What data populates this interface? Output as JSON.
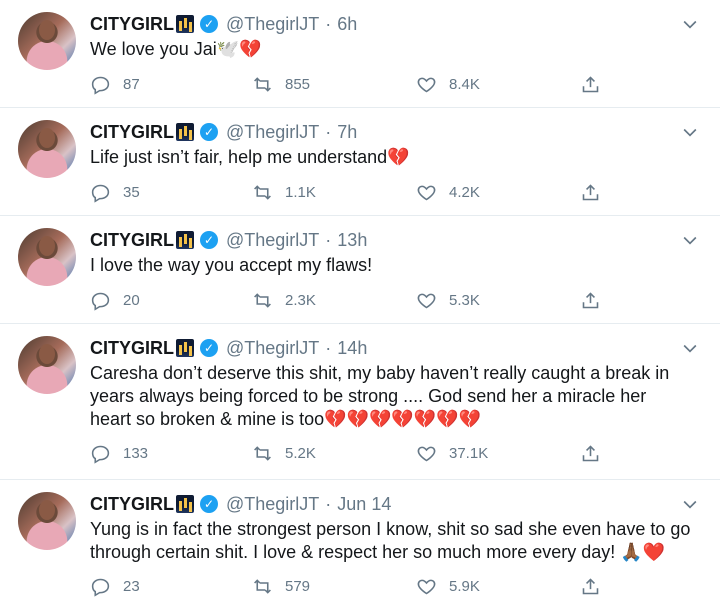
{
  "tweets": [
    {
      "name": "CITYGIRL",
      "handle": "@ThegirlJT",
      "time": "6h",
      "text": "We love you Jai",
      "emoji": "🕊️💔",
      "replies": "87",
      "retweets": "855",
      "likes": "8.4K"
    },
    {
      "name": "CITYGIRL",
      "handle": "@ThegirlJT",
      "time": "7h",
      "text": "Life just isn’t fair, help me understand",
      "emoji": "💔",
      "replies": "35",
      "retweets": "1.1K",
      "likes": "4.2K"
    },
    {
      "name": "CITYGIRL",
      "handle": "@ThegirlJT",
      "time": "13h",
      "text": "I love the way you accept my flaws!",
      "emoji": "",
      "replies": "20",
      "retweets": "2.3K",
      "likes": "5.3K"
    },
    {
      "name": "CITYGIRL",
      "handle": "@ThegirlJT",
      "time": "14h",
      "text": "Caresha don’t deserve this shit, my baby haven’t really caught a break in years always being forced to be strong .... God send her a miracle her heart so broken & mine is too",
      "emoji": "💔💔💔💔💔💔💔",
      "replies": "133",
      "retweets": "5.2K",
      "likes": "37.1K"
    },
    {
      "name": "CITYGIRL",
      "handle": "@ThegirlJT",
      "time": "Jun 14",
      "text": "Yung is in fact the strongest person I know, shit so sad she even have to go through certain shit. I love & respect her so much more every day!",
      "emoji": "🙏🏾❤️",
      "replies": "23",
      "retweets": "579",
      "likes": "5.9K"
    }
  ],
  "separator": "·",
  "icons": {
    "verified": "verified-badge-icon",
    "reply": "reply-icon",
    "retweet": "retweet-icon",
    "like": "like-icon",
    "share": "share-icon",
    "more": "chevron-down-icon"
  },
  "colors": {
    "verified": "#1da1f2",
    "muted": "#657786",
    "text": "#14171a",
    "divider": "#e6ecf0"
  }
}
